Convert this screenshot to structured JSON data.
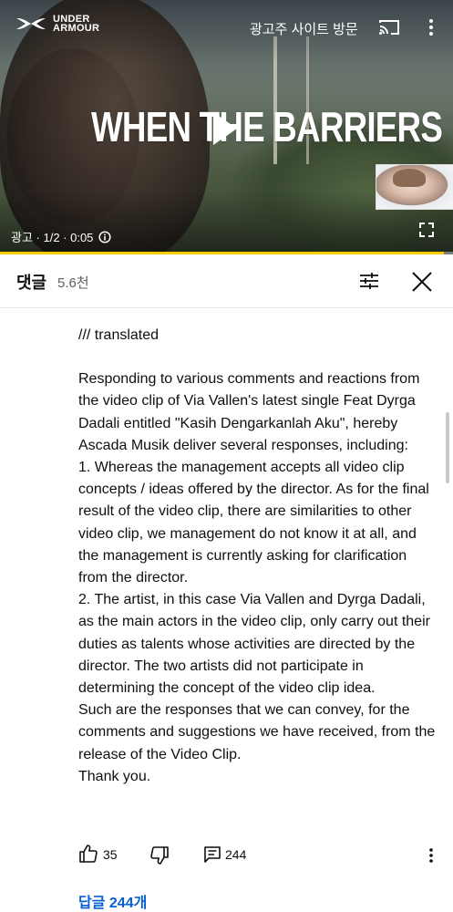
{
  "ad": {
    "brand_line1": "UNDER",
    "brand_line2": "ARMOUR",
    "site_link": "광고주 사이트 방문",
    "headline": "WHEN THE BARRIERS",
    "ad_counter": "광고 · 1/2 · 0:05",
    "progress": 0.98
  },
  "comments": {
    "title": "댓글",
    "count": "5.6천"
  },
  "comment": {
    "paragraphs": [
      "/// translated",
      "",
      "Responding to various comments and reactions from the video clip of Via Vallen's latest single Feat Dyrga Dadali entitled \"Kasih Dengarkanlah Aku\", hereby Ascada Musik deliver several responses, including:",
      "1. Whereas the management accepts all video clip concepts / ideas offered by the director. As for the final result of the video clip, there are similarities to other video clip, we management do not know it at all, and the management is currently asking for clarification from the director.",
      "2. The artist, in this case Via Vallen and Dyrga Dadali, as the main actors in the video clip, only carry out their duties as talents whose activities are directed by the director. The two artists did not participate in determining the concept of the video clip idea.",
      "Such are the responses that we can convey, for the comments and suggestions we have received, from the release of the Video Clip.",
      "Thank you."
    ],
    "likes": "35",
    "reply_count": "244",
    "replies_link": "답글 244개"
  },
  "colors": {
    "progress": "#ffcc00",
    "link": "#065fd4"
  }
}
